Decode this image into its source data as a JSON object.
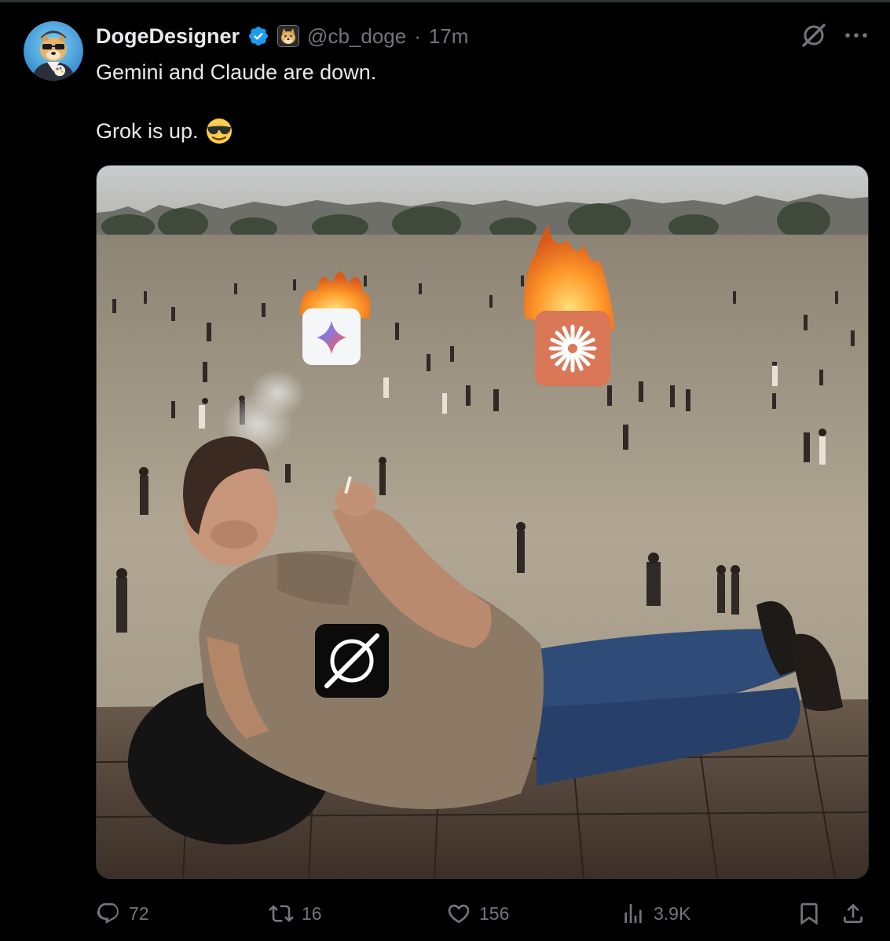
{
  "post": {
    "display_name": "DogeDesigner",
    "handle": "@cb_doge",
    "separator": "·",
    "timestamp": "17m",
    "text_line1": "Gemini and Claude are down.",
    "text_line2": "Grok is up."
  },
  "icons": {
    "verified": "verified-badge-icon",
    "affiliate": "doge-affiliate-badge",
    "grok": "grok-icon",
    "more": "more-icon",
    "emoji": "smiling-face-with-sunglasses",
    "media_overlays": [
      "gemini-logo",
      "claude-logo",
      "grok-logo",
      "fire"
    ]
  },
  "actions": {
    "replies": "72",
    "reposts": "16",
    "likes": "156",
    "views": "3.9K"
  },
  "colors": {
    "background": "#000000",
    "primary_text": "#e7e9ea",
    "secondary_text": "#71767b",
    "verified_blue": "#1d9bf0",
    "claude_orange": "#d97757"
  }
}
